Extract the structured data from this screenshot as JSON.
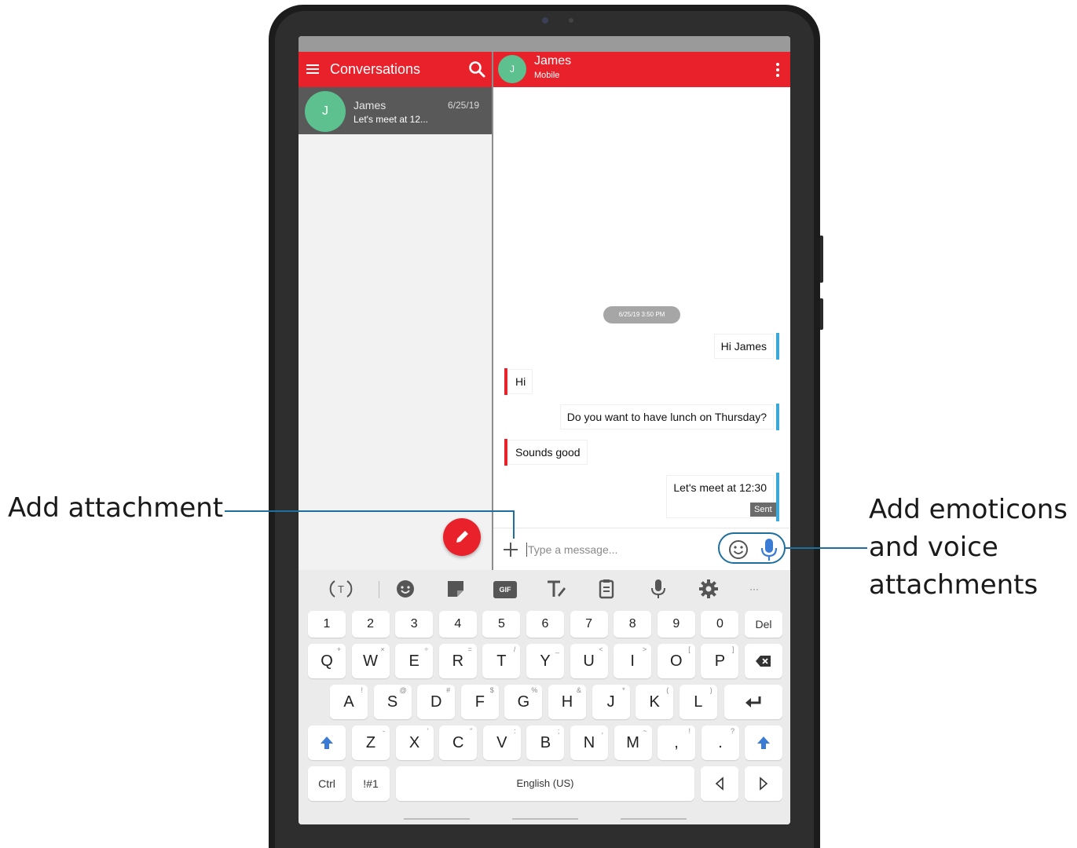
{
  "left_pane": {
    "title": "Conversations",
    "conversation": {
      "avatar_letter": "J",
      "name": "James",
      "date": "6/25/19",
      "preview": "Let's meet at 12..."
    }
  },
  "chat": {
    "avatar_letter": "J",
    "contact_name": "James",
    "contact_sub": "Mobile",
    "timestamp": "6/25/19 3:50 PM",
    "messages": [
      {
        "direction": "out",
        "text": "Hi James"
      },
      {
        "direction": "in",
        "text": "Hi"
      },
      {
        "direction": "out",
        "text": "Do you want to have lunch on Thursday?"
      },
      {
        "direction": "in",
        "text": "Sounds good"
      },
      {
        "direction": "out",
        "text": "Let's meet at 12:30",
        "status": "Sent"
      }
    ],
    "input_placeholder": "Type a message..."
  },
  "keyboard": {
    "toolbar_icons": [
      "translate-icon",
      "emoji-icon",
      "sticker-icon",
      "gif-icon",
      "text-style-icon",
      "clipboard-icon",
      "mic-icon",
      "settings-icon",
      "more-icon"
    ],
    "gif_label": "GIF",
    "more_label": "···",
    "number_row": [
      "1",
      "2",
      "3",
      "4",
      "5",
      "6",
      "7",
      "8",
      "9",
      "0"
    ],
    "del_label": "Del",
    "row1": [
      [
        "Q",
        "+"
      ],
      [
        "W",
        "×"
      ],
      [
        "E",
        "÷"
      ],
      [
        "R",
        "="
      ],
      [
        "T",
        "/"
      ],
      [
        "Y",
        "_"
      ],
      [
        "U",
        "<"
      ],
      [
        "I",
        ">"
      ],
      [
        "O",
        "["
      ],
      [
        "P",
        "]"
      ]
    ],
    "row2": [
      [
        "A",
        "!"
      ],
      [
        "S",
        "@"
      ],
      [
        "D",
        "#"
      ],
      [
        "F",
        "$"
      ],
      [
        "G",
        "%"
      ],
      [
        "H",
        "&"
      ],
      [
        "J",
        "*"
      ],
      [
        "K",
        "("
      ],
      [
        "L",
        ")"
      ]
    ],
    "row3": [
      [
        "Z",
        "-"
      ],
      [
        "X",
        "'"
      ],
      [
        "C",
        "\""
      ],
      [
        "V",
        ":"
      ],
      [
        "B",
        ";"
      ],
      [
        "N",
        ","
      ],
      [
        "M",
        "~"
      ]
    ],
    "comma_label": ",",
    "comma_sup": "!",
    "period_label": ".",
    "period_sup": "?",
    "ctrl_label": "Ctrl",
    "symbols_label": "!#1",
    "space_label": "English (US)"
  },
  "annotations": {
    "left": "Add attachment",
    "right_line1": "Add emoticons",
    "right_line2": "and voice",
    "right_line3": "attachments"
  },
  "colors": {
    "accent_red": "#e8212b",
    "avatar_green": "#5cc08f",
    "out_bubble_bar": "#3aa8d8",
    "callout_blue": "#1f6f9e"
  }
}
